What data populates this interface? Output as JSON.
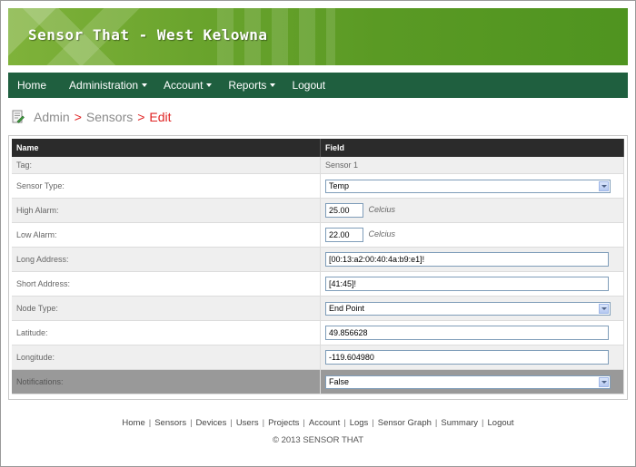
{
  "header": {
    "title": "Sensor That - West Kelowna"
  },
  "nav": {
    "items": [
      {
        "label": "Home",
        "dropdown": false
      },
      {
        "label": "Administration",
        "dropdown": true
      },
      {
        "label": "Account",
        "dropdown": true
      },
      {
        "label": "Reports",
        "dropdown": true
      },
      {
        "label": "Logout",
        "dropdown": false
      }
    ]
  },
  "breadcrumb": {
    "root": "Admin",
    "section": "Sensors",
    "current": "Edit",
    "separator": ">"
  },
  "table": {
    "headers": {
      "name": "Name",
      "field": "Field"
    },
    "tag": {
      "label": "Tag:",
      "value": "Sensor 1"
    },
    "sensor_type": {
      "label": "Sensor Type:",
      "value": "Temp"
    },
    "high_alarm": {
      "label": "High Alarm:",
      "value": "25.00",
      "unit": "Celcius"
    },
    "low_alarm": {
      "label": "Low Alarm:",
      "value": "22.00",
      "unit": "Celcius"
    },
    "long_address": {
      "label": "Long Address:",
      "value": "[00:13:a2:00:40:4a:b9:e1]!"
    },
    "short_address": {
      "label": "Short Address:",
      "value": "[41:45]!"
    },
    "node_type": {
      "label": "Node Type:",
      "value": "End Point"
    },
    "latitude": {
      "label": "Latitude:",
      "value": "49.856628"
    },
    "longitude": {
      "label": "Longitude:",
      "value": "-119.604980"
    },
    "notifications": {
      "label": "Notifications:",
      "value": "False"
    }
  },
  "footer": {
    "links": [
      "Home",
      "Sensors",
      "Devices",
      "Users",
      "Projects",
      "Account",
      "Logs",
      "Sensor Graph",
      "Summary",
      "Logout"
    ],
    "copyright": "© 2013 SENSOR THAT"
  },
  "colors": {
    "banner": "#6aa42d",
    "navbar": "#1f5f3f",
    "breadcrumb_accent": "#e02424",
    "table_header": "#2b2b2b"
  }
}
